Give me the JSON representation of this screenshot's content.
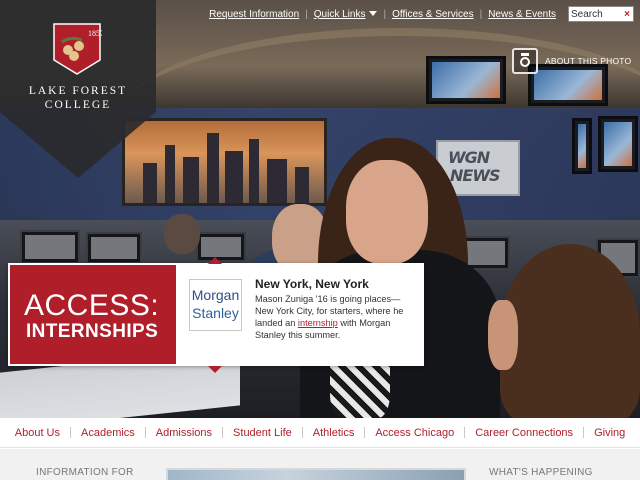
{
  "brand": {
    "crest_year": "1857",
    "name_line1": "LAKE FOREST",
    "name_line2": "COLLEGE",
    "color_red": "#b01e2a"
  },
  "utility_nav": {
    "items": [
      {
        "label": "Request Information"
      },
      {
        "label": "Quick Links",
        "has_dropdown": true
      },
      {
        "label": "Offices & Services"
      },
      {
        "label": "News & Events"
      }
    ],
    "search": {
      "value": "Search"
    }
  },
  "hero": {
    "about_photo_label": "ABOUT THIS PHOTO",
    "sign_text_1": "WGN",
    "sign_text_2": "NEWS",
    "camera_icon": "camera-icon"
  },
  "feature": {
    "badge_line1": "ACCESS:",
    "badge_line2": "INTERNSHIPS",
    "partner_logo_line1": "Morgan",
    "partner_logo_line2": "Stanley",
    "title": "New York, New York",
    "body_before": "Mason Zuniga '16 is going places—New York City, for starters, where he landed an ",
    "body_link": "internship",
    "body_after": " with Morgan Stanley this summer."
  },
  "main_nav": {
    "items": [
      {
        "label": "About Us"
      },
      {
        "label": "Academics"
      },
      {
        "label": "Admissions"
      },
      {
        "label": "Student Life"
      },
      {
        "label": "Athletics"
      },
      {
        "label": "Access Chicago"
      },
      {
        "label": "Career Connections"
      },
      {
        "label": "Giving"
      }
    ]
  },
  "sections": {
    "info_for": "INFORMATION FOR",
    "whats_happening": "WHAT'S HAPPENING"
  }
}
